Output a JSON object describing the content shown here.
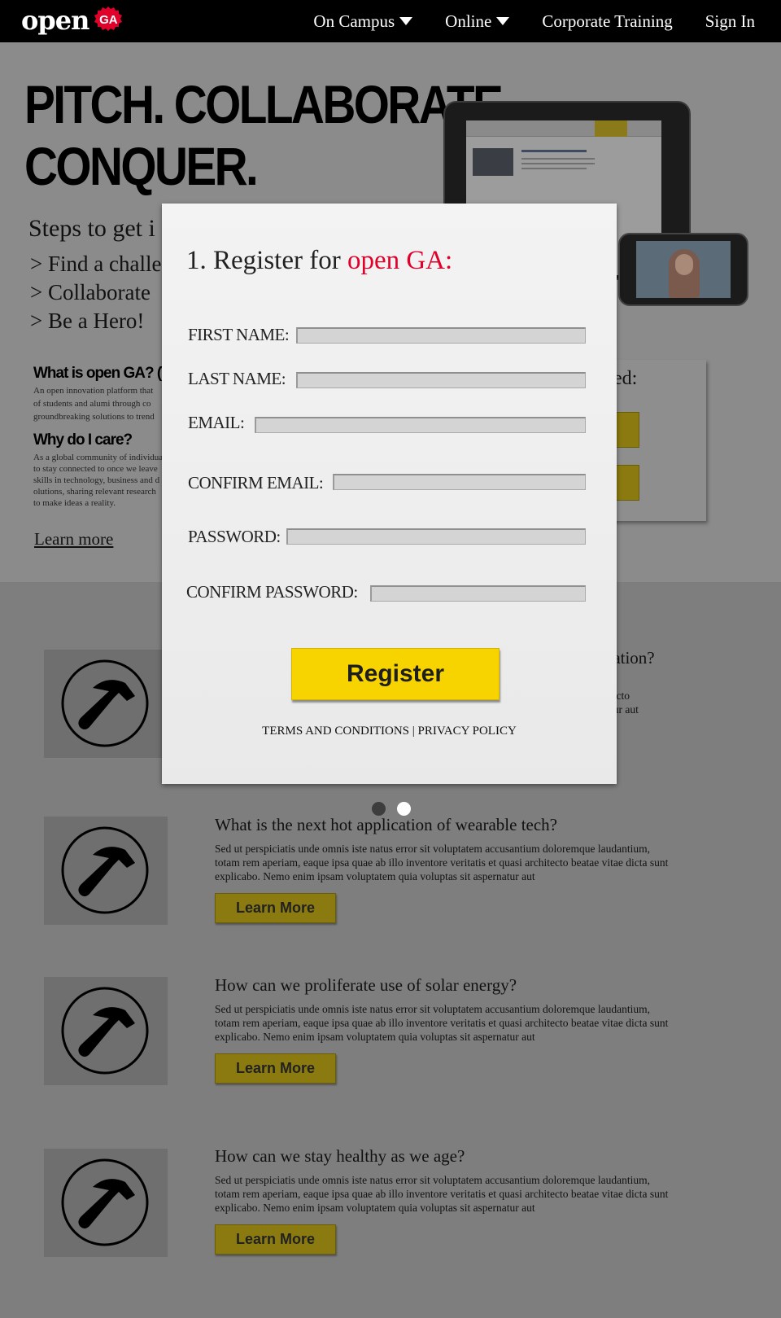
{
  "nav": {
    "logo_text": "open",
    "logo_badge": "GA",
    "items": [
      {
        "label": "On Campus",
        "has_dropdown": true
      },
      {
        "label": "Online",
        "has_dropdown": true
      },
      {
        "label": "Corporate Training",
        "has_dropdown": false
      },
      {
        "label": "Sign In",
        "has_dropdown": false
      }
    ]
  },
  "hero": {
    "headline_line1": "PITCH. COLLABORATE.",
    "headline_line2": "CONQUER.",
    "steps_title": "Steps to get i",
    "steps": [
      "> Find a challe",
      "> Collaborate",
      "> Be a Hero!"
    ],
    "what_title": "What is open GA? (Wh",
    "what_body": [
      "An open innovation platform that",
      "of students and alumi through co",
      "groundbreaking solutions to trend"
    ],
    "why_title": "Why do I care?",
    "why_body": [
      "As a global community of individua",
      "to stay connected to once we leave",
      "skills in technology, business and d",
      "olutions, sharing relevant research",
      "to make ideas a reality."
    ],
    "learn_more": "Learn more",
    "side_card_title": "ed:"
  },
  "modal": {
    "title_prefix": "1. Register for ",
    "title_accent": "open GA:",
    "fields": [
      {
        "label": "FIRST NAME:",
        "value": ""
      },
      {
        "label": "LAST NAME:",
        "value": ""
      },
      {
        "label": "EMAIL:",
        "value": ""
      },
      {
        "label": "CONFIRM EMAIL:",
        "value": ""
      },
      {
        "label": "PASSWORD:",
        "value": ""
      },
      {
        "label": "CONFIRM PASSWORD:",
        "value": ""
      }
    ],
    "register_label": "Register",
    "terms_label": "TERMS AND CONDITIONS",
    "separator": "|",
    "privacy_label": "PRIVACY POLICY"
  },
  "challenges": [
    {
      "title": "cation?",
      "body": [
        "itecto",
        "atur aut"
      ]
    },
    {
      "title": "What is the next hot application of wearable tech?",
      "body": "Sed ut perspiciatis unde omnis iste natus error sit voluptatem accusantium doloremque laudantium, totam rem aperiam, eaque ipsa quae ab illo inventore veritatis et quasi architecto beatae vitae dicta sunt explicabo. Nemo enim ipsam voluptatem quia voluptas sit aspernatur aut",
      "button": "Learn More"
    },
    {
      "title": "How can we proliferate use of solar energy?",
      "body": "Sed ut perspiciatis unde omnis iste natus error sit voluptatem accusantium doloremque laudantium, totam rem aperiam, eaque ipsa quae ab illo inventore veritatis et quasi architecto beatae vitae dicta sunt explicabo. Nemo enim ipsam voluptatem quia voluptas sit aspernatur aut",
      "button": "Learn More"
    },
    {
      "title": "How can we stay healthy as we age?",
      "body": "Sed ut perspiciatis unde omnis iste natus error sit voluptatem accusantium doloremque laudantium, totam rem aperiam, eaque ipsa quae ab illo inventore veritatis et quasi architecto beatae vitae dicta sunt explicabo. Nemo enim ipsam voluptatem quia voluptas sit aspernatur aut",
      "button": "Learn More"
    }
  ],
  "carousel": {
    "active_index": 1,
    "count": 2
  },
  "colors": {
    "accent_red": "#e0002a",
    "register_yellow": "#f7d300",
    "dimmed_yellow": "#8a7a10",
    "overlay_gray": "#7e7e7e"
  },
  "icons": {
    "challenge": "hammer-icon",
    "dropdown": "chevron-down-icon"
  }
}
